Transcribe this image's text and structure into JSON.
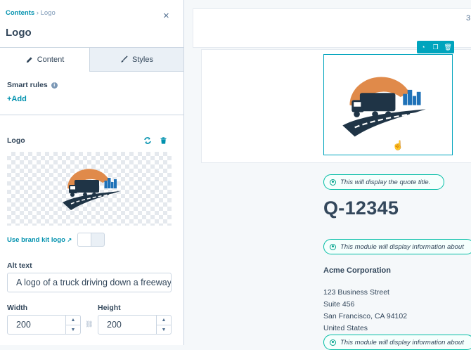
{
  "panel": {
    "breadcrumb_link": "Contents",
    "breadcrumb_sep": "›",
    "breadcrumb_current": "Logo",
    "close_label": "×",
    "title": "Logo",
    "tabs": [
      {
        "label": "Content",
        "icon": "pencil-icon",
        "active": true
      },
      {
        "label": "Styles",
        "icon": "brush-icon",
        "active": false
      }
    ],
    "smart_rules_label": "Smart rules",
    "add_label": "+Add",
    "logo_label": "Logo",
    "brand_kit_label": "Use brand kit logo",
    "alt_text_label": "Alt text",
    "alt_text_value": "A logo of a truck driving down a freeway",
    "width_label": "Width",
    "width_value": "200",
    "height_label": "Height",
    "height_value": "200"
  },
  "canvas": {
    "page_number": "3",
    "quote_pill": "This will display the quote title.",
    "quote_number": "Q-12345",
    "module_pill": "This module will display information about",
    "company": "Acme Corporation",
    "address": [
      "123 Business Street",
      "Suite 456",
      "San Francisco, CA 94102",
      "United States"
    ],
    "bottom_pill": "This module will display information about"
  },
  "colors": {
    "accent": "#0091ae",
    "selection": "#00a4bd",
    "pill_border": "#00bda5",
    "text": "#33475b"
  }
}
